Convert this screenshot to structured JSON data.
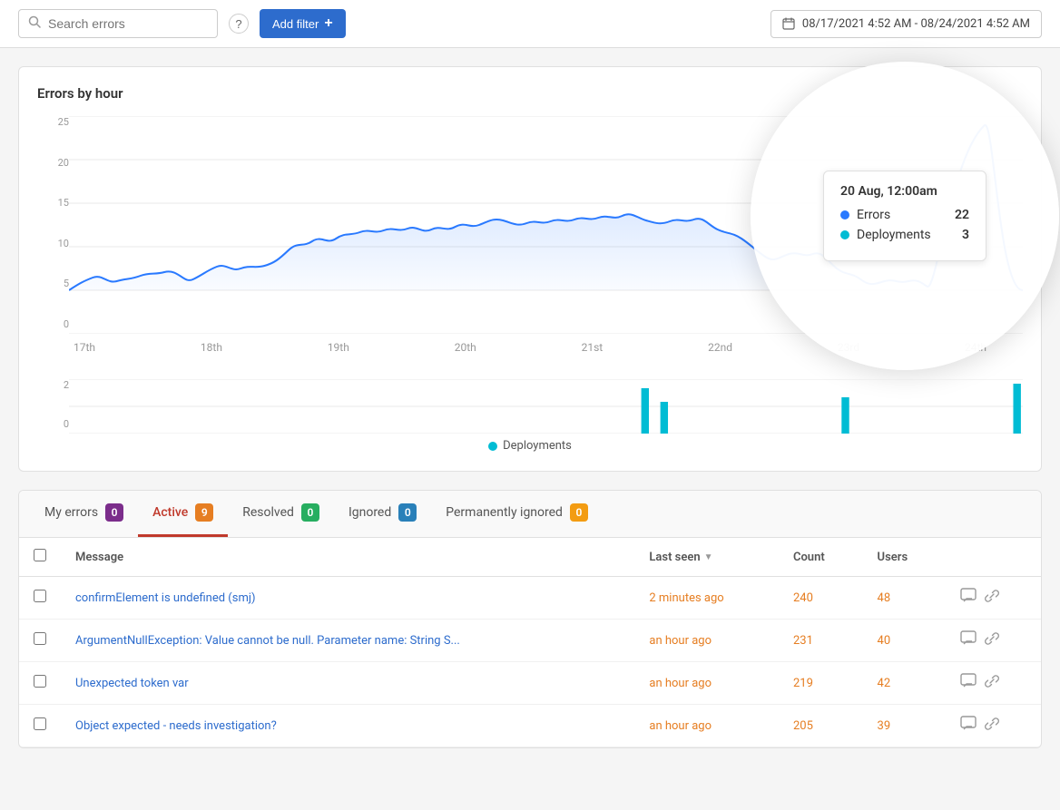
{
  "topbar": {
    "search_placeholder": "Search errors",
    "help_label": "?",
    "add_filter_label": "Add filter",
    "date_range": "08/17/2021 4:52 AM - 08/24/2021 4:52 AM"
  },
  "chart": {
    "title": "Errors by hour",
    "y_labels": [
      "25",
      "20",
      "15",
      "10",
      "5",
      "0"
    ],
    "x_labels": [
      "17th",
      "18th",
      "19th",
      "20th",
      "21st",
      "22nd",
      "23rd",
      "24th"
    ],
    "deploy_y_labels": [
      "2",
      "0"
    ],
    "deployments_label": "Deployments",
    "tooltip": {
      "date": "20 Aug, 12:00am",
      "errors_label": "Errors",
      "errors_value": "22",
      "deployments_label": "Deployments",
      "deployments_value": "3"
    }
  },
  "tabs": [
    {
      "id": "my-errors",
      "label": "My errors",
      "count": "0",
      "badge_class": "badge-purple"
    },
    {
      "id": "active",
      "label": "Active",
      "count": "9",
      "badge_class": "badge-orange",
      "active": true
    },
    {
      "id": "resolved",
      "label": "Resolved",
      "count": "0",
      "badge_class": "badge-green"
    },
    {
      "id": "ignored",
      "label": "Ignored",
      "count": "0",
      "badge_class": "badge-blue"
    },
    {
      "id": "permanently-ignored",
      "label": "Permanently ignored",
      "count": "0",
      "badge_class": "badge-yellow"
    }
  ],
  "table": {
    "columns": {
      "checkbox": "",
      "message": "Message",
      "last_seen": "Last seen",
      "count": "Count",
      "users": "Users"
    },
    "rows": [
      {
        "message": "confirmElement is undefined (smj)",
        "last_seen": "2 minutes ago",
        "count": "240",
        "users": "48"
      },
      {
        "message": "ArgumentNullException: Value cannot be null. Parameter name: String S...",
        "last_seen": "an hour ago",
        "count": "231",
        "users": "40"
      },
      {
        "message": "Unexpected token var",
        "last_seen": "an hour ago",
        "count": "219",
        "users": "42"
      },
      {
        "message": "Object expected - needs investigation?",
        "last_seen": "an hour ago",
        "count": "205",
        "users": "39"
      }
    ]
  }
}
